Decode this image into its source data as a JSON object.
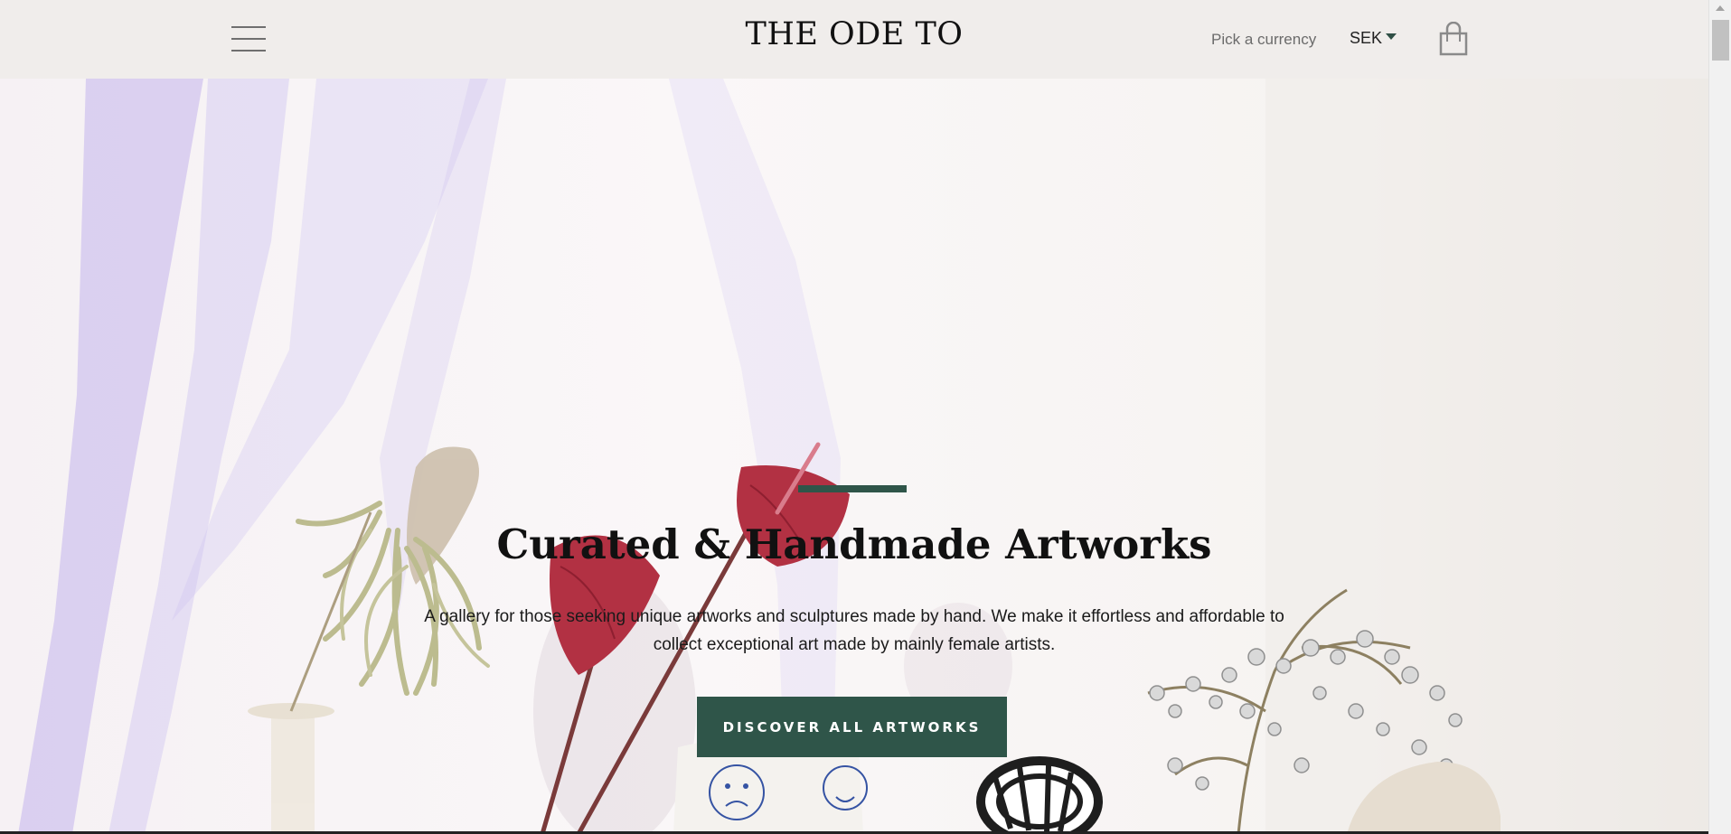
{
  "header": {
    "logo": "THE ODE TO",
    "menu_icon": "hamburger-menu-icon",
    "currency_label": "Pick a currency",
    "currency_value": "SEK",
    "cart_icon": "shopping-bag-icon"
  },
  "hero": {
    "title": "Curated & Handmade Artworks",
    "description_line1": "A gallery for those seeking unique artworks and sculptures made by hand. We make it effortless and affordable to",
    "description_line2": "collect exceptional art made by mainly female artists.",
    "cta_label": "DISCOVER ALL ARTWORKS"
  },
  "colors": {
    "accent": "#2f5549",
    "header_bg": "#f0edeb",
    "tulle": "#b7a7ec",
    "anthurium": "#b23143"
  }
}
